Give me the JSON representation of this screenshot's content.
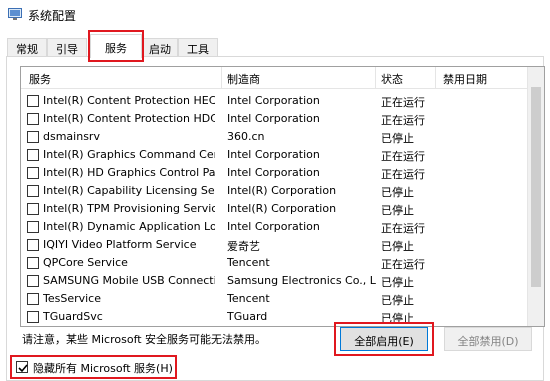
{
  "window": {
    "title": "系统配置"
  },
  "tabs": [
    {
      "label": "常规"
    },
    {
      "label": "引导"
    },
    {
      "label": "服务"
    },
    {
      "label": "启动"
    },
    {
      "label": "工具"
    }
  ],
  "columns": {
    "service": "服务",
    "manufacturer": "制造商",
    "status": "状态",
    "disabled_date": "禁用日期"
  },
  "services": [
    {
      "name": "Intel(R) Content Protection HECI ...",
      "manufacturer": "Intel Corporation",
      "status": "正在运行"
    },
    {
      "name": "Intel(R) Content Protection HDCP...",
      "manufacturer": "Intel Corporation",
      "status": "正在运行"
    },
    {
      "name": "dsmainsrv",
      "manufacturer": "360.cn",
      "status": "已停止"
    },
    {
      "name": "Intel(R) Graphics Command Cent...",
      "manufacturer": "Intel Corporation",
      "status": "正在运行"
    },
    {
      "name": "Intel(R) HD Graphics Control Pan...",
      "manufacturer": "Intel Corporation",
      "status": "正在运行"
    },
    {
      "name": "Intel(R) Capability Licensing Servi...",
      "manufacturer": "Intel(R) Corporation",
      "status": "已停止"
    },
    {
      "name": "Intel(R) TPM Provisioning Service",
      "manufacturer": "Intel(R) Corporation",
      "status": "已停止"
    },
    {
      "name": "Intel(R) Dynamic Application Loa...",
      "manufacturer": "Intel Corporation",
      "status": "正在运行"
    },
    {
      "name": "IQIYI Video Platform Service",
      "manufacturer": "爱奇艺",
      "status": "已停止"
    },
    {
      "name": "QPCore Service",
      "manufacturer": "Tencent",
      "status": "正在运行"
    },
    {
      "name": "SAMSUNG Mobile USB Connecti...",
      "manufacturer": "Samsung Electronics Co., L...",
      "status": "已停止"
    },
    {
      "name": "TesService",
      "manufacturer": "Tencent",
      "status": "已停止"
    },
    {
      "name": "TGuardSvc",
      "manufacturer": "TGuard",
      "status": "已停止"
    }
  ],
  "note": "请注意，某些 Microsoft 安全服务可能无法禁用。",
  "buttons": {
    "enable_all": "全部启用(E)",
    "disable_all": "全部禁用(D)"
  },
  "hide_ms": {
    "label": "隐藏所有 Microsoft 服务(H)",
    "checked": true
  },
  "colors": {
    "highlight": "#e0181f",
    "focus_border": "#0078d7"
  }
}
